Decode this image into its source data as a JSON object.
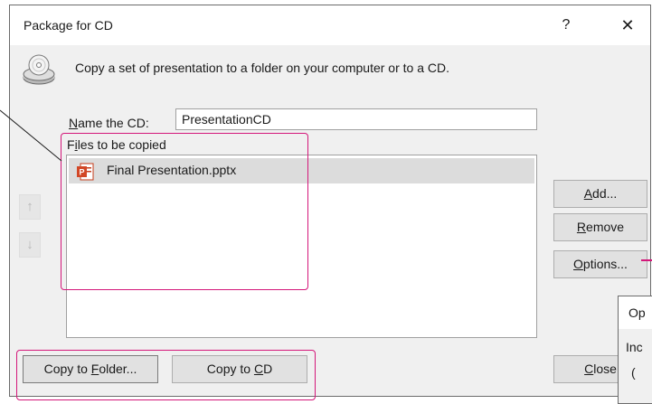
{
  "dialog": {
    "title": "Package for CD",
    "help": "?",
    "close": "✕",
    "instruction": "Copy a set of presentation to a folder on your computer or to a CD.",
    "name_label_mnemonic": "N",
    "name_label_rest": "ame the CD:",
    "name_value": "PresentationCD",
    "files_label_pre": "F",
    "files_label_mnemonic": "i",
    "files_label_rest": "les to be copied",
    "files": [
      {
        "name": "Final Presentation.pptx"
      }
    ],
    "move_up": "↑",
    "move_down": "↓",
    "buttons": {
      "add_mnemonic": "A",
      "add_rest": "dd...",
      "remove_mnemonic": "R",
      "remove_rest": "emove",
      "options_mnemonic": "O",
      "options_rest": "ptions...",
      "copy_folder_pre": "Copy to ",
      "copy_folder_mnemonic": "F",
      "copy_folder_rest": "older...",
      "copy_cd_pre": "Copy to ",
      "copy_cd_mnemonic": "C",
      "copy_cd_rest": "D",
      "close_mnemonic": "C",
      "close_rest": "lose"
    }
  },
  "options_popup": {
    "title_partial": "Op",
    "text_partial": "Inc",
    "text2_partial": "("
  },
  "colors": {
    "highlight": "#d4177a"
  }
}
